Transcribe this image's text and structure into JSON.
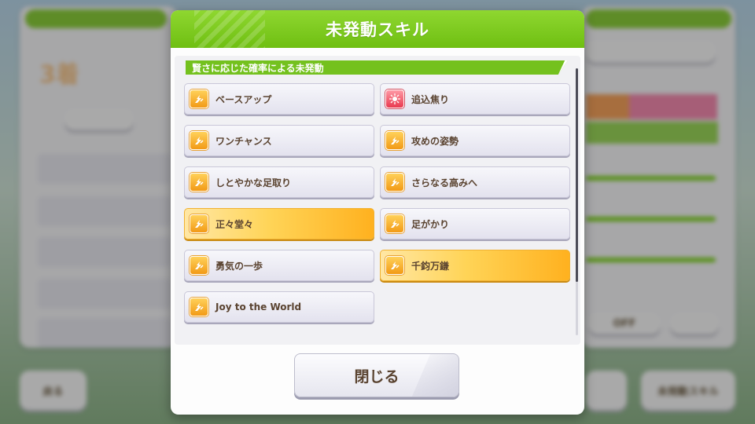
{
  "dialog": {
    "title": "未発動スキル",
    "section_title": "賢さに応じた確率による未発動",
    "close_label": "閉じる"
  },
  "skills": [
    {
      "label": "ベースアップ",
      "icon": "speed-up-icon",
      "style": "normal"
    },
    {
      "label": "追込焦り",
      "icon": "debuff-icon",
      "style": "normal"
    },
    {
      "label": "ワンチャンス",
      "icon": "speed-up-icon",
      "style": "normal"
    },
    {
      "label": "攻めの姿勢",
      "icon": "speed-up-icon",
      "style": "normal"
    },
    {
      "label": "しとやかな足取り",
      "icon": "speed-up-icon",
      "style": "normal"
    },
    {
      "label": "さらなる高みへ",
      "icon": "speed-up-icon",
      "style": "normal"
    },
    {
      "label": "正々堂々",
      "icon": "speed-up-icon",
      "style": "gold"
    },
    {
      "label": "足がかり",
      "icon": "speed-up-icon",
      "style": "normal"
    },
    {
      "label": "勇気の一歩",
      "icon": "speed-up-icon",
      "style": "normal"
    },
    {
      "label": "千鈞万鎌",
      "icon": "speed-up-icon",
      "style": "gold"
    },
    {
      "label": "Joy to the World",
      "icon": "speed-up-icon",
      "style": "normal"
    }
  ],
  "background": {
    "back_label": "戻る",
    "skill_button_label": "未発動スキル",
    "auto_label": "OFF",
    "grade_label": "3着"
  },
  "colors": {
    "header_green": "#7ccb1e",
    "text_brown": "#5a4330",
    "gold": "#ffc94a"
  }
}
